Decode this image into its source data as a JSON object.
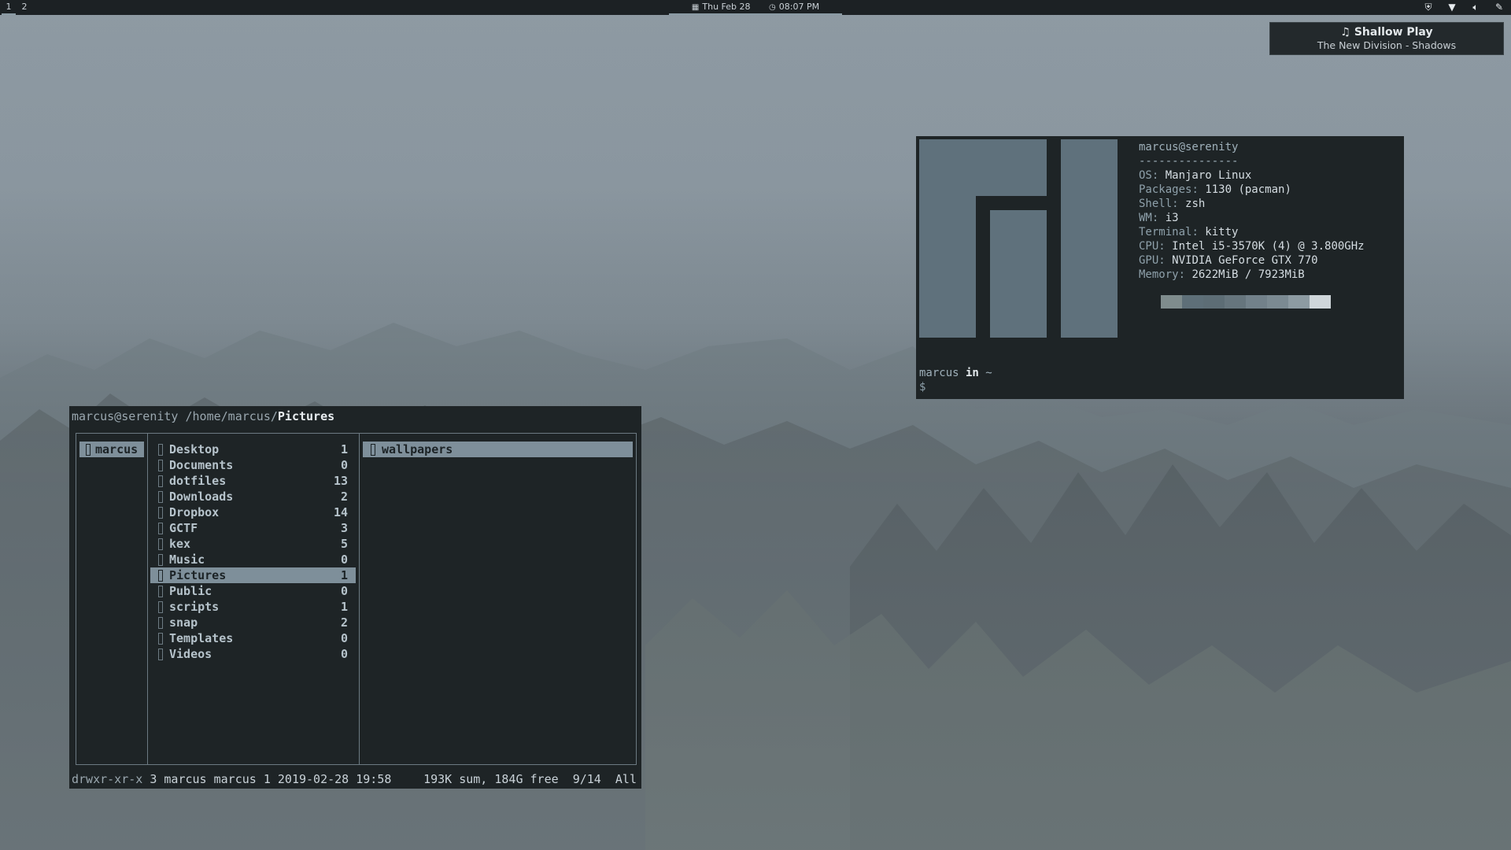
{
  "topbar": {
    "workspaces": [
      "1",
      "2"
    ],
    "date": "Thu Feb 28",
    "time": "08:07 PM",
    "icons": [
      "calendar-icon",
      "clock-icon",
      "shield-icon",
      "wifi-icon",
      "volume-icon",
      "pen-icon"
    ]
  },
  "notification": {
    "title": "Shallow Play",
    "subtitle": "The New Division - Shadows",
    "icon": "music-icon"
  },
  "ranger": {
    "header_prefix": "marcus@serenity /home/marcus/",
    "header_current": "Pictures",
    "parent": [
      "marcus"
    ],
    "entries": [
      {
        "name": "Desktop",
        "count": "1"
      },
      {
        "name": "Documents",
        "count": "0"
      },
      {
        "name": "dotfiles",
        "count": "13"
      },
      {
        "name": "Downloads",
        "count": "2"
      },
      {
        "name": "Dropbox",
        "count": "14"
      },
      {
        "name": "GCTF",
        "count": "3"
      },
      {
        "name": "kex",
        "count": "5"
      },
      {
        "name": "Music",
        "count": "0"
      },
      {
        "name": "Pictures",
        "count": "1",
        "selected": true
      },
      {
        "name": "Public",
        "count": "0"
      },
      {
        "name": "scripts",
        "count": "1"
      },
      {
        "name": "snap",
        "count": "2"
      },
      {
        "name": "Templates",
        "count": "0"
      },
      {
        "name": "Videos",
        "count": "0"
      }
    ],
    "preview": [
      "wallpapers"
    ],
    "status": {
      "perms": "drwxr-xr-x",
      "meta": " 3 marcus marcus 1 2019-02-28 19:58",
      "right": "193K sum, 184G free  9/14  All"
    }
  },
  "neofetch": {
    "user": "marcus@serenity",
    "separator": "---------------",
    "fields": [
      {
        "key": "OS",
        "value": "Manjaro Linux"
      },
      {
        "key": "Packages",
        "value": "1130 (pacman)"
      },
      {
        "key": "Shell",
        "value": "zsh"
      },
      {
        "key": "WM",
        "value": "i3"
      },
      {
        "key": "Terminal",
        "value": "kitty"
      },
      {
        "key": "CPU",
        "value": "Intel i5-3570K (4) @ 3.800GHz"
      },
      {
        "key": "GPU",
        "value": "NVIDIA GeForce GTX 770"
      },
      {
        "key": "Memory",
        "value": "2622MiB / 7923MiB"
      }
    ],
    "palette": [
      "#7f8c8d",
      "#5e6f78",
      "#5d6d75",
      "#66757d",
      "#72818a",
      "#7b8a92",
      "#8d9ba2",
      "#cfd6da"
    ],
    "logo_color": "#5f717c",
    "prompt_user": "marcus",
    "prompt_in": " in ",
    "prompt_dir": "~",
    "prompt_symbol": "$"
  }
}
